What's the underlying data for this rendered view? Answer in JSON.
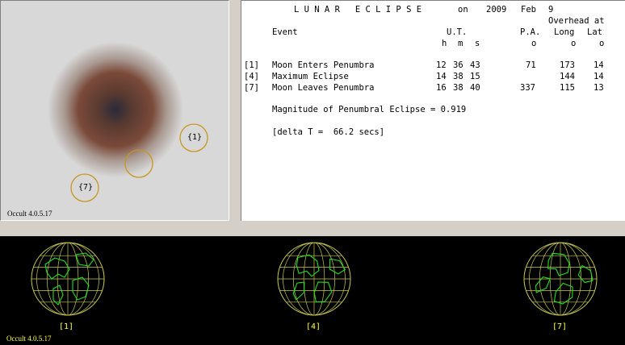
{
  "diagram": {
    "version": "Occult 4.0.5.17",
    "markers": [
      {
        "label": "{1}"
      },
      {
        "label": ""
      },
      {
        "label": "{7}"
      }
    ],
    "colors": {
      "shadow_core": "#3a3a4a",
      "penumbra": "#7a4a3a",
      "background": "#d8d8d8",
      "marker_ring": "#c8961e"
    }
  },
  "report": {
    "title": "L U N A R   E C L I P S E",
    "on": "on",
    "year": "2009",
    "month": "Feb",
    "day": "9",
    "overhead_at": "Overhead at",
    "headers": {
      "event": "Event",
      "ut": "U.T.",
      "pa": "P.A.",
      "long": "Long",
      "lat": "Lat"
    },
    "units": {
      "h": "h",
      "m": "m",
      "s": "s",
      "deg_pa": "o",
      "deg_long": "o",
      "deg_lat": "o"
    },
    "events": [
      {
        "id": "[1]",
        "name": "Moon Enters Penumbra",
        "h": "12",
        "m": "36",
        "s": "43",
        "pa": "71",
        "long": "173",
        "lat": "14"
      },
      {
        "id": "[4]",
        "name": "Maximum Eclipse",
        "h": "14",
        "m": "38",
        "s": "15",
        "pa": "",
        "long": "144",
        "lat": "14"
      },
      {
        "id": "[7]",
        "name": "Moon Leaves Penumbra",
        "h": "16",
        "m": "38",
        "s": "40",
        "pa": "337",
        "long": "115",
        "lat": "13"
      }
    ],
    "magnitude": "Magnitude of Penumbral Eclipse = 0.919",
    "delta_t": "[delta T =  66.2 secs]"
  },
  "globes": {
    "labels": [
      "[1]",
      "[4]",
      "[7]"
    ],
    "version": "Occult 4.0.5.17",
    "colors": {
      "grid": "#c8c850",
      "land": "#20e020",
      "label": "#ffff40"
    }
  }
}
